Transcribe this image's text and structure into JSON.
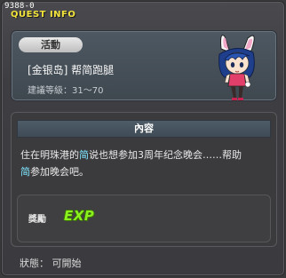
{
  "window": {
    "quest_id": "9388-0",
    "title": "QUEST INFO"
  },
  "quest": {
    "category": "活動",
    "name": "[金银岛] 帮简跑腿",
    "level_range": "建議等級：31～70"
  },
  "content": {
    "header": "內容",
    "text_before_1": "住在明珠港的",
    "highlight_1": "简",
    "text_after_1": "说也想参加3周年纪念晚会……帮助",
    "highlight_2": "简",
    "text_after_2": "参加晚会吧。",
    "highlight_color": "#7fe6ff"
  },
  "reward": {
    "label": "獎勵",
    "exp_icon_text": "EXP"
  },
  "status": {
    "text": "狀態：  可開始"
  },
  "icons": {
    "npc": "bunny-girl-npc-portrait",
    "exp": "exp-reward-icon"
  }
}
